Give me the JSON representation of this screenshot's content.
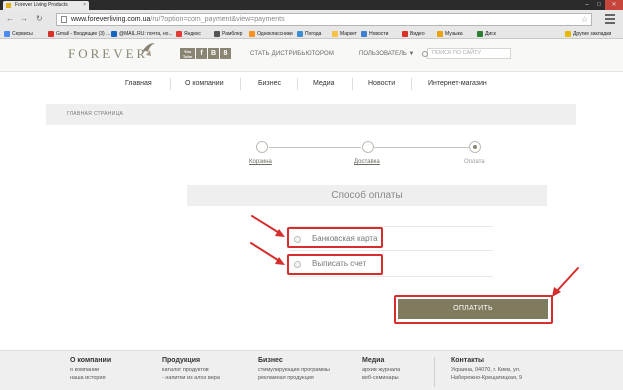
{
  "browser": {
    "tab_title": "Forever Living Products",
    "tab_close": "×",
    "url_host": "www.foreverliving.com.ua",
    "url_path": "/ru/?option=com_payment&view=payments",
    "bookmarks": [
      {
        "label": "Сервисы",
        "color": "#4c8bf5"
      },
      {
        "label": "Gmail - Входящие (3) ...",
        "color": "#d93025"
      },
      {
        "label": "@MAIL.RU: почта, но...",
        "color": "#1565c0"
      },
      {
        "label": "Яндекс",
        "color": "#e53935"
      },
      {
        "label": "Рамблер",
        "color": "#555555"
      },
      {
        "label": "Одноклассники",
        "color": "#f7931e"
      },
      {
        "label": "Погода",
        "color": "#3d8fd1"
      },
      {
        "label": "Маркет",
        "color": "#f6c344"
      },
      {
        "label": "Новости",
        "color": "#3d7fd1"
      },
      {
        "label": "Видео",
        "color": "#d93025"
      },
      {
        "label": "Музыка",
        "color": "#e6a40f"
      },
      {
        "label": "Диск",
        "color": "#2e7d32"
      },
      {
        "label": "Другие закладки",
        "color": "#e6b800"
      }
    ]
  },
  "header": {
    "logo": "FOREVER",
    "social": [
      "You Tube",
      "f",
      "B",
      "8"
    ],
    "distributor_link": "СТАТЬ ДИСТРИБЬЮТОРОМ",
    "user_menu": "ПОЛЬЗОВАТЕЛЬ ▼",
    "search_placeholder": "ПОИСК ПО САЙТУ"
  },
  "nav": [
    "Главная",
    "О компании",
    "Бизнес",
    "Медиа",
    "Новости",
    "Интернет-магазин"
  ],
  "breadcrumb": "ГЛАВНАЯ СТРАНИЦА",
  "steps": [
    {
      "label": "Корзина",
      "active": false
    },
    {
      "label": "Доставка",
      "active": false
    },
    {
      "label": "Оплата",
      "active": true
    }
  ],
  "payment": {
    "title": "Способ оплаты",
    "options": [
      "Банковская карта",
      "Выписать счет"
    ],
    "pay_button": "ОПЛАТИТЬ"
  },
  "colors": {
    "accent": "#807a5f",
    "highlight": "#d62d2d"
  },
  "footer": {
    "columns": [
      {
        "title": "О компании",
        "items": [
          "о компании",
          "наша история"
        ]
      },
      {
        "title": "Продукция",
        "items": [
          "каталог продуктов",
          "- напитки из алоэ вера"
        ]
      },
      {
        "title": "Бизнес",
        "items": [
          "стимулирующие программы",
          "рекламная продукция"
        ]
      },
      {
        "title": "Медиа",
        "items": [
          "архив журнала",
          "веб-семинары"
        ]
      },
      {
        "title": "Контакты",
        "items": [
          "Украина, 04070, г. Киев, ул.",
          "Набережно-Крещатицкая, 9"
        ]
      }
    ]
  }
}
